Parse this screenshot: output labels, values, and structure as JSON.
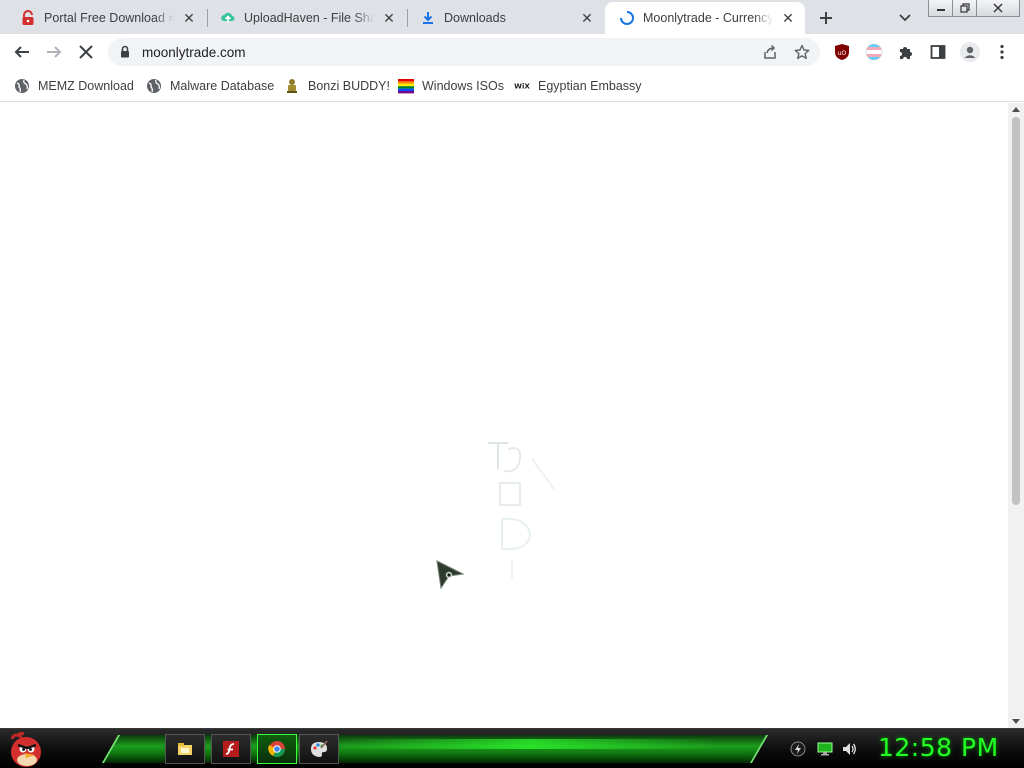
{
  "tabs": [
    {
      "title": "Portal Free Download » S",
      "icon": "red-padlock-icon"
    },
    {
      "title": "UploadHaven - File Sharing",
      "icon": "uploadhaven-icon"
    },
    {
      "title": "Downloads",
      "icon": "download-icon"
    },
    {
      "title": "Moonlytrade - Currency E",
      "icon": "loading-spinner-icon",
      "active": true
    }
  ],
  "toolbar": {
    "url": "moonlytrade.com"
  },
  "bookmarks": [
    {
      "label": "MEMZ Download",
      "icon": "globe-icon"
    },
    {
      "label": "Malware Database",
      "icon": "globe-icon"
    },
    {
      "label": "Bonzi BUDDY!",
      "icon": "bonzi-icon"
    },
    {
      "label": "Windows ISOs",
      "icon": "rainbow-flag-icon"
    },
    {
      "label": "Egyptian Embassy",
      "icon": "wix-icon"
    }
  ],
  "taskbar": {
    "clock": "12:58 PM",
    "items": [
      "file-explorer-icon",
      "flash-icon",
      "chrome-icon",
      "paint-icon"
    ]
  },
  "colors": {
    "accent_green": "#22ff22",
    "tab_strip": "#dee1e6"
  }
}
